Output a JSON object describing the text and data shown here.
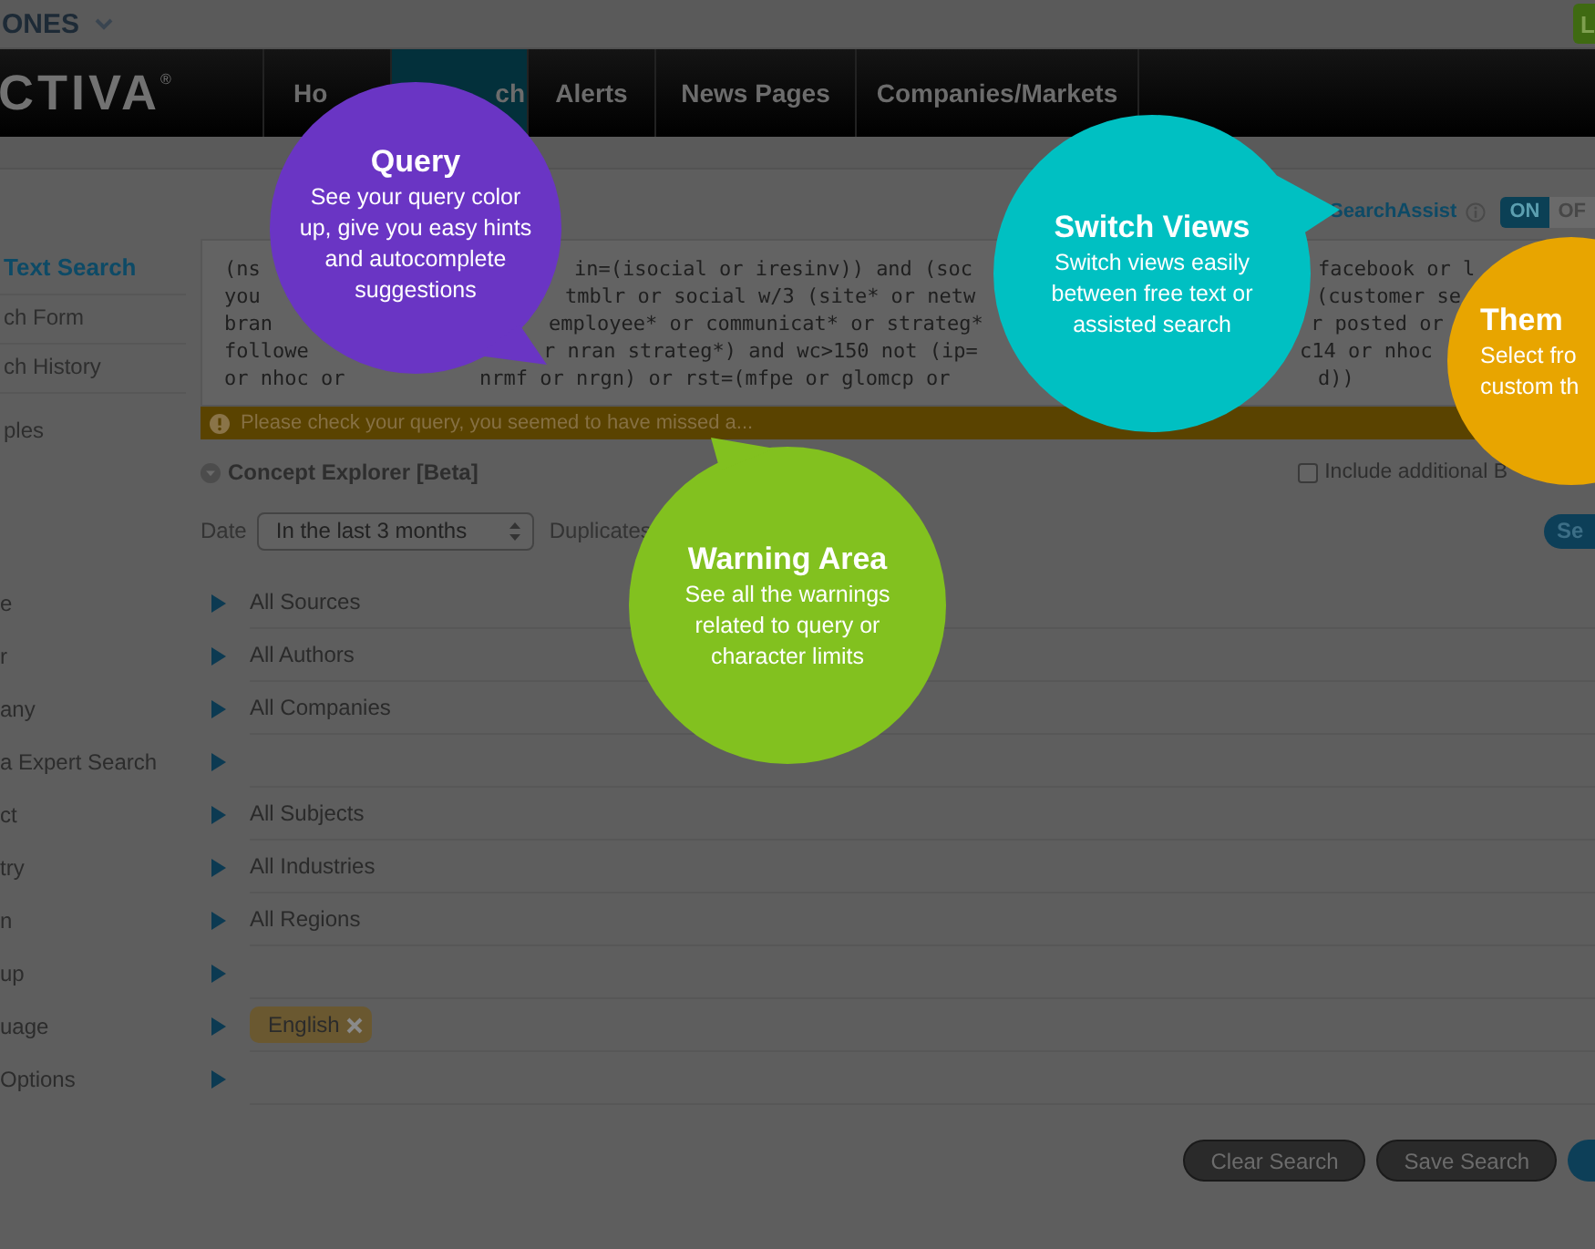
{
  "top_bar": {
    "brand": "ONES",
    "account_button": "L"
  },
  "nav": {
    "logo": "CTIVA",
    "logo_mark": "®",
    "tabs": [
      {
        "label": "Ho",
        "selected": false
      },
      {
        "label": "ch",
        "selected": true
      },
      {
        "label": "Alerts",
        "selected": false
      },
      {
        "label": "News Pages",
        "selected": false
      },
      {
        "label": "Companies/Markets",
        "selected": false
      }
    ]
  },
  "sidebar": {
    "items": [
      {
        "label": "Text Search",
        "selected": true
      },
      {
        "label": "ch Form",
        "selected": false
      },
      {
        "label": "ch History",
        "selected": false
      },
      {
        "label": "ples",
        "selected": false
      }
    ]
  },
  "search_assist": {
    "label": "SearchAssist",
    "on_label": "ON",
    "off_label": "OF",
    "on": true
  },
  "query": {
    "lines": [
      [
        "(ns",
        "in=(isocial or iresinv)) and (soc",
        "facebook or l"
      ],
      [
        "you",
        "tmblr or social w/3 (site* or netw",
        "(customer se"
      ],
      [
        "bran",
        "employee* or communicat* or strateg*",
        "r posted or"
      ],
      [
        "followe",
        "r nran strateg*) and wc>150 not (ip=",
        "c14 or nhoc"
      ],
      [
        "or nhoc or",
        "nrmf or nrgn) or rst=(mfpe or glomcp or",
        "d))"
      ]
    ]
  },
  "warning": "Please check your query, you seemed to have missed a...",
  "concept_explorer": {
    "label": "Concept Explorer [Beta]"
  },
  "include_additional": {
    "label": "Include additional B",
    "checked": false
  },
  "date": {
    "label": "Date",
    "value": "In the last 3 months"
  },
  "duplicates_label": "Duplicates",
  "search_button": "Se",
  "filters": [
    {
      "label": "e",
      "value": "All Sources"
    },
    {
      "label": "r",
      "value": "All Authors"
    },
    {
      "label": "any",
      "value": "All Companies"
    },
    {
      "label": "a Expert Search"
    },
    {
      "label": "ct",
      "value": "All Subjects"
    },
    {
      "label": "try",
      "value": "All Industries"
    },
    {
      "label": "n",
      "value": "All Regions"
    },
    {
      "label": "up"
    },
    {
      "label": "uage",
      "tags": [
        "English"
      ]
    },
    {
      "label": "Options"
    }
  ],
  "buttons": [
    "Clear Search",
    "Save Search"
  ],
  "callouts": [
    {
      "kind": "query",
      "title": "Query",
      "lines": [
        "See your query color",
        "up, give you easy hints",
        "and autocomplete",
        "suggestions"
      ],
      "color": "#6a35c4"
    },
    {
      "kind": "switch",
      "title": "Switch Views",
      "lines": [
        "Switch views easily",
        "between free text or",
        "assisted search"
      ],
      "color": "#00c0c2"
    },
    {
      "kind": "warning",
      "title": "Warning Area",
      "lines": [
        "See all the warnings",
        "related to query or",
        "character limits"
      ],
      "color": "#82c11f"
    },
    {
      "kind": "theme",
      "title": "Them",
      "lines": [
        "Select fro",
        "custom th"
      ],
      "color": "#e8a500"
    }
  ]
}
